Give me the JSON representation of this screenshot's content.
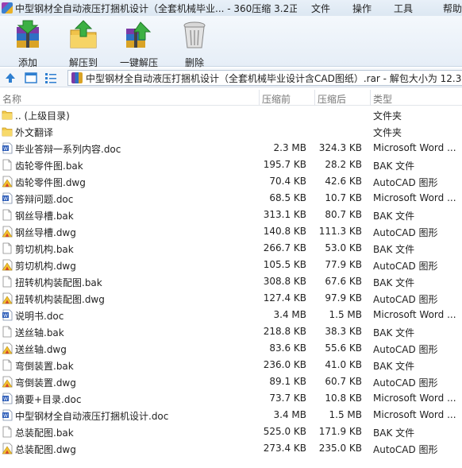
{
  "window": {
    "title": "中型钢材全自动液压打捆机设计（全套机械毕业... - 360压缩 3.2正式",
    "menu": [
      "文件",
      "操作",
      "工具",
      "帮助"
    ]
  },
  "toolbar": {
    "add_label": "添加",
    "extract_label": "解压到",
    "oneclick_label": "一键解压",
    "delete_label": "删除"
  },
  "address": {
    "path": "中型钢材全自动液压打捆机设计（全套机械毕业设计含CAD图纸）.rar - 解包大小为 12.3"
  },
  "columns": {
    "name": "名称",
    "compressed": "压缩前",
    "original": "压缩后",
    "type": "类型"
  },
  "files": [
    {
      "name": ".. (上级目录)",
      "compressed": "",
      "original": "",
      "type": "文件夹",
      "icon": "folder-icon"
    },
    {
      "name": "外文翻译",
      "compressed": "",
      "original": "",
      "type": "文件夹",
      "icon": "folder-icon"
    },
    {
      "name": "毕业答辩一系列内容.doc",
      "compressed": "2.3 MB",
      "original": "324.3 KB",
      "type": "Microsoft Word ...",
      "icon": "word-icon"
    },
    {
      "name": "齿轮零件图.bak",
      "compressed": "195.7 KB",
      "original": "28.2 KB",
      "type": "BAK 文件",
      "icon": "file-icon"
    },
    {
      "name": "齿轮零件图.dwg",
      "compressed": "70.4 KB",
      "original": "42.6 KB",
      "type": "AutoCAD 图形",
      "icon": "cad-icon"
    },
    {
      "name": "答辩问题.doc",
      "compressed": "68.5 KB",
      "original": "10.7 KB",
      "type": "Microsoft Word ...",
      "icon": "word-icon"
    },
    {
      "name": "钢丝导槽.bak",
      "compressed": "313.1 KB",
      "original": "80.7 KB",
      "type": "BAK 文件",
      "icon": "file-icon"
    },
    {
      "name": "钢丝导槽.dwg",
      "compressed": "140.8 KB",
      "original": "111.3 KB",
      "type": "AutoCAD 图形",
      "icon": "cad-icon"
    },
    {
      "name": "剪切机构.bak",
      "compressed": "266.7 KB",
      "original": "53.0 KB",
      "type": "BAK 文件",
      "icon": "file-icon"
    },
    {
      "name": "剪切机构.dwg",
      "compressed": "105.5 KB",
      "original": "77.9 KB",
      "type": "AutoCAD 图形",
      "icon": "cad-icon"
    },
    {
      "name": "扭转机构装配图.bak",
      "compressed": "308.8 KB",
      "original": "67.6 KB",
      "type": "BAK 文件",
      "icon": "file-icon"
    },
    {
      "name": "扭转机构装配图.dwg",
      "compressed": "127.4 KB",
      "original": "97.9 KB",
      "type": "AutoCAD 图形",
      "icon": "cad-icon"
    },
    {
      "name": "说明书.doc",
      "compressed": "3.4 MB",
      "original": "1.5 MB",
      "type": "Microsoft Word ...",
      "icon": "word-icon"
    },
    {
      "name": "送丝轴.bak",
      "compressed": "218.8 KB",
      "original": "38.3 KB",
      "type": "BAK 文件",
      "icon": "file-icon"
    },
    {
      "name": "送丝轴.dwg",
      "compressed": "83.6 KB",
      "original": "55.6 KB",
      "type": "AutoCAD 图形",
      "icon": "cad-icon"
    },
    {
      "name": "弯倒装置.bak",
      "compressed": "236.0 KB",
      "original": "41.0 KB",
      "type": "BAK 文件",
      "icon": "file-icon"
    },
    {
      "name": "弯倒装置.dwg",
      "compressed": "89.1 KB",
      "original": "60.7 KB",
      "type": "AutoCAD 图形",
      "icon": "cad-icon"
    },
    {
      "name": "摘要+目录.doc",
      "compressed": "73.7 KB",
      "original": "10.8 KB",
      "type": "Microsoft Word ...",
      "icon": "word-icon"
    },
    {
      "name": "中型钢材全自动液压打捆机设计.doc",
      "compressed": "3.4 MB",
      "original": "1.5 MB",
      "type": "Microsoft Word ...",
      "icon": "word-icon"
    },
    {
      "name": "总装配图.bak",
      "compressed": "525.0 KB",
      "original": "171.9 KB",
      "type": "BAK 文件",
      "icon": "file-icon"
    },
    {
      "name": "总装配图.dwg",
      "compressed": "273.4 KB",
      "original": "235.0 KB",
      "type": "AutoCAD 图形",
      "icon": "cad-icon"
    }
  ]
}
